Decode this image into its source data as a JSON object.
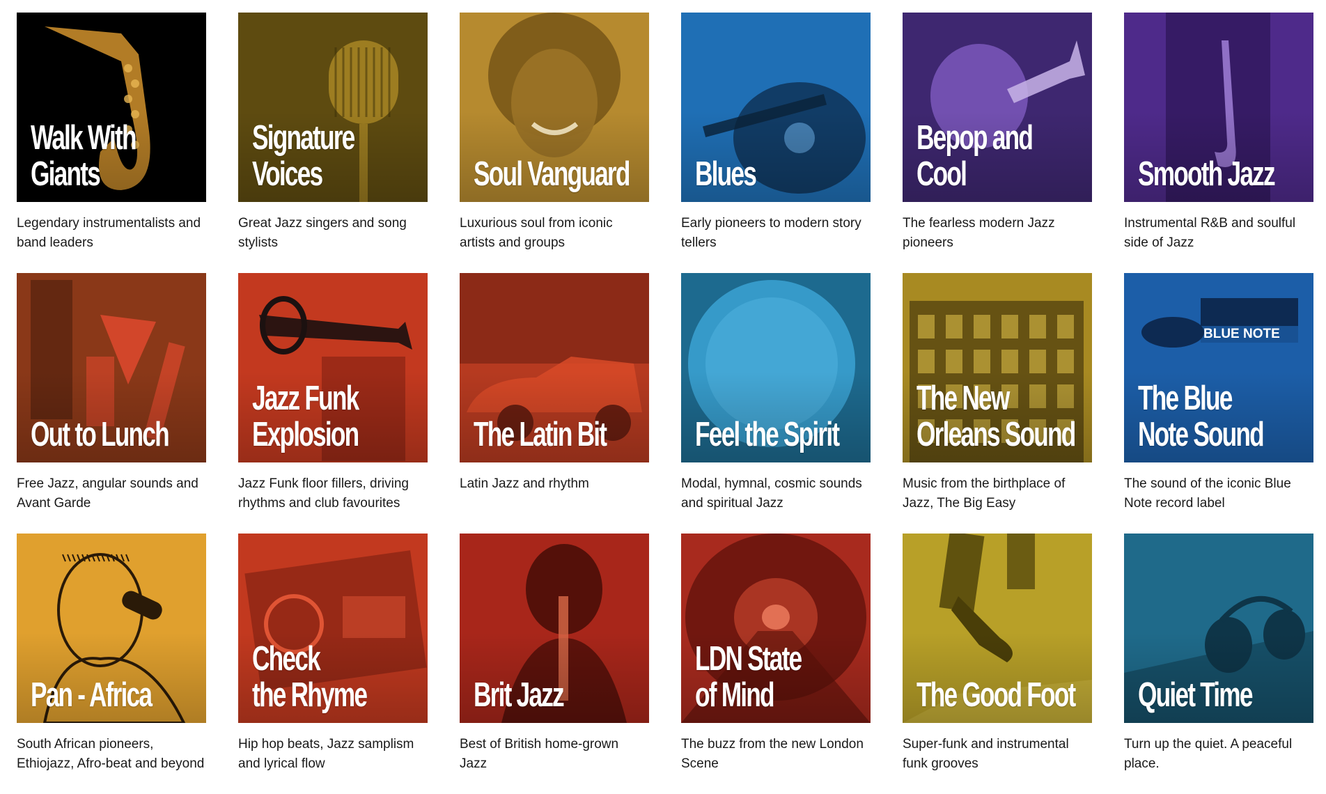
{
  "playlists": [
    {
      "title": "Walk With\nGiants",
      "description": "Legendary instrumentalists and band leaders",
      "color": "#000000",
      "accent": "#c58a2a",
      "art_icon": "saxophone-icon"
    },
    {
      "title": "Signature Voices",
      "description": "Great Jazz singers and song stylists",
      "color": "#5e4b10",
      "accent": "#a88624",
      "art_icon": "microphone-icon"
    },
    {
      "title": "Soul Vanguard",
      "description": "Luxurious soul from iconic artists and groups",
      "color": "#b68a2f",
      "accent": "#7a5818",
      "art_icon": "singer-portrait-icon"
    },
    {
      "title": "Blues",
      "description": "Early pioneers to modern story tellers",
      "color": "#1f6fb5",
      "accent": "#0f3458",
      "art_icon": "guitar-icon"
    },
    {
      "title": "Bepop and Cool",
      "description": "The fearless modern Jazz pioneers",
      "color": "#3e2770",
      "accent": "#7f5bc0",
      "art_icon": "trumpet-player-icon"
    },
    {
      "title": "Smooth Jazz",
      "description": "Instrumental R&B and soulful side of Jazz",
      "color": "#4e2a8a",
      "accent": "#2c1656",
      "art_icon": "saxophone-player-icon"
    },
    {
      "title": "Out to Lunch",
      "description": "Free Jazz, angular sounds and Avant Garde",
      "color": "#8a3818",
      "accent": "#d2462a",
      "art_icon": "abstract-shapes-icon"
    },
    {
      "title": "Jazz Funk\nExplosion",
      "description": "Jazz Funk floor fillers, driving rhythms and club favourites",
      "color": "#c3391f",
      "accent": "#1c1110",
      "art_icon": "trumpet-icon"
    },
    {
      "title": "The Latin Bit",
      "description": "Latin Jazz and rhythm",
      "color": "#b63a20",
      "accent": "#6a1e10",
      "art_icon": "vintage-car-icon"
    },
    {
      "title": "Feel the Spirit",
      "description": "Modal, hymnal, cosmic sounds and spiritual Jazz",
      "color": "#1d6a8f",
      "accent": "#3aa0cf",
      "art_icon": "sun-icon"
    },
    {
      "title": "The New\nOrleans Sound",
      "description": "Music from the birthplace of Jazz, The Big Easy",
      "color": "#a88a22",
      "accent": "#5a4810",
      "art_icon": "building-icon"
    },
    {
      "title": "The Blue\nNote Sound",
      "description": "The sound of the iconic Blue Note record label",
      "color": "#1c5ea8",
      "accent": "#0d2a52",
      "logo_text": "BLUE NOTE",
      "art_icon": "blue-note-logo-icon"
    },
    {
      "title": "Pan - Africa",
      "description": "South African pioneers, Ethiojazz, Afro-beat and beyond",
      "color": "#e0a02e",
      "accent": "#2a1a08",
      "art_icon": "singer-illustration-icon"
    },
    {
      "title": "Check\nthe Rhyme",
      "description": "Hip hop beats, Jazz samplism and lyrical flow",
      "color": "#c2391f",
      "accent": "#7a2010",
      "art_icon": "boombox-icon"
    },
    {
      "title": "Brit Jazz",
      "description": "Best of British home-grown Jazz",
      "color": "#a8261a",
      "accent": "#4a0e08",
      "art_icon": "clarinet-player-icon"
    },
    {
      "title": "LDN State\nof Mind",
      "description": "The buzz from the new London Scene",
      "color": "#a82a1e",
      "accent": "#5a1008",
      "art_icon": "tunnel-icon"
    },
    {
      "title": "The Good Foot",
      "description": "Super-funk and instrumental funk grooves",
      "color": "#b8a028",
      "accent": "#4a3e08",
      "art_icon": "sneaker-icon"
    },
    {
      "title": "Quiet Time",
      "description": "Turn up the quiet. A peaceful place.",
      "color": "#1f6a8a",
      "accent": "#0e3548",
      "art_icon": "headphones-icon"
    }
  ]
}
